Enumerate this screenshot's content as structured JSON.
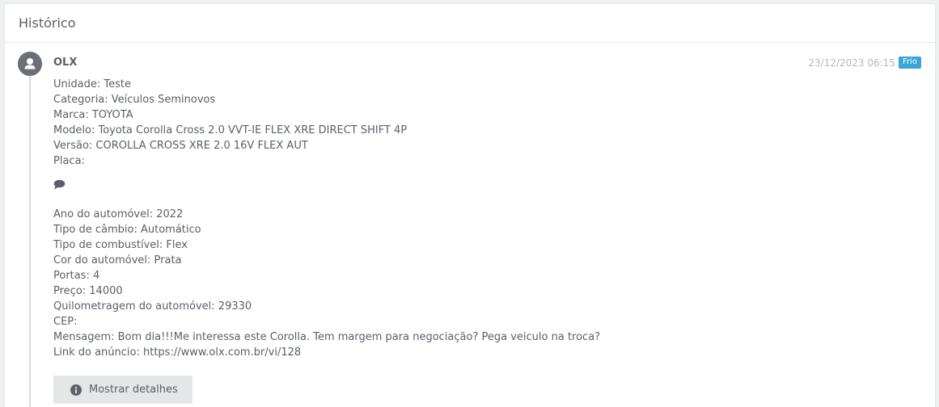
{
  "panel": {
    "title": "Histórico"
  },
  "entry": {
    "author": "OLX",
    "date": "23/12/2023 06:15",
    "badge": "Frio",
    "badge_color": "#3aa6d8",
    "icon": "user-icon",
    "lines_top": [
      "Unidade: Teste",
      "Categoria: Veículos Seminovos",
      "Marca: TOYOTA",
      "Modelo: Toyota Corolla Cross 2.0 VVT-IE FLEX XRE DIRECT SHIFT 4P",
      "Versão: COROLLA CROSS XRE 2.0 16V FLEX AUT",
      "Placa:"
    ],
    "comment_icon": "comment-icon",
    "lines_bottom": [
      "Ano do automóvel: 2022",
      "Tipo de câmbio: Automático",
      "Tipo de combustível: Flex",
      "Cor do automóvel: Prata",
      "Portas: 4",
      "Preço: 14000",
      "Quilometragem do automóvel: 29330",
      "CEP:",
      "Mensagem: Bom dia!!!Me interessa este Corolla. Tem margem para negociação? Pega veiculo na troca?",
      "Link do anúncio: https://www.olx.com.br/vi/128"
    ],
    "details_button": {
      "label": "Mostrar detalhes",
      "icon": "info-icon"
    }
  }
}
